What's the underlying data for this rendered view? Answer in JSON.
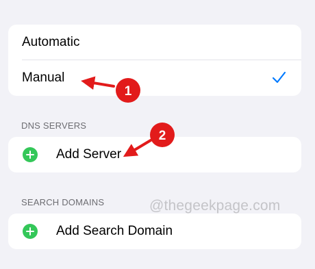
{
  "config_options": {
    "automatic_label": "Automatic",
    "manual_label": "Manual",
    "selected": "Manual"
  },
  "dns_servers": {
    "header": "DNS SERVERS",
    "add_label": "Add Server"
  },
  "search_domains": {
    "header": "SEARCH DOMAINS",
    "add_label": "Add Search Domain"
  },
  "watermark": "@thegeekpage.com",
  "annotations": [
    {
      "number": "1"
    },
    {
      "number": "2"
    }
  ],
  "colors": {
    "background": "#f2f2f7",
    "checkmark": "#007aff",
    "add_icon": "#34c759",
    "annotation": "#e21b1b",
    "section_header": "#6d6d72"
  },
  "icons": {
    "checkmark": "checkmark-icon",
    "add": "plus-circle-icon",
    "arrow": "red-arrow-icon"
  }
}
